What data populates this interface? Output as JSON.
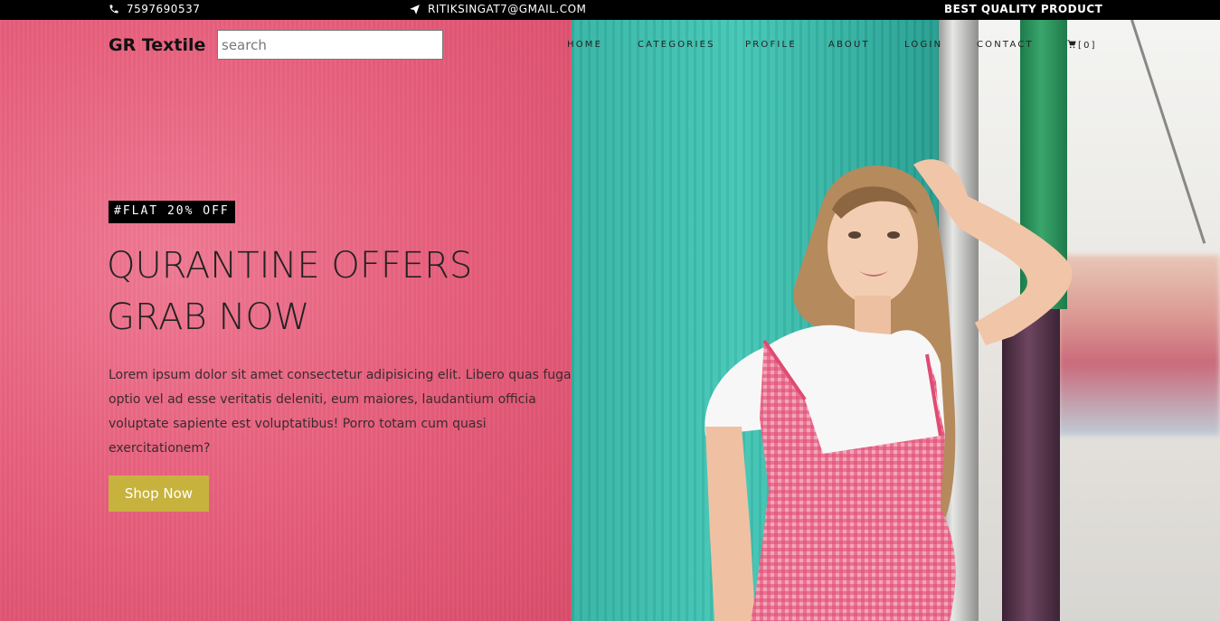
{
  "topbar": {
    "phone": "7597690537",
    "phone_icon": "phone-icon",
    "email": "RITIKSINGAT7@GMAIL.COM",
    "email_icon": "paper-plane-icon",
    "tagline": "BEST QUALITY PRODUCT"
  },
  "header": {
    "brand": "GR Textile",
    "search_placeholder": "search",
    "nav": [
      "HOME",
      "CATEGORIES",
      "PROFILE",
      "ABOUT",
      "LOGIN",
      "CONTACT"
    ],
    "cart_label": "[0]",
    "cart_icon": "cart-icon"
  },
  "hero": {
    "badge": "#FLAT 20% OFF",
    "headline_line1": "QURANTINE OFFERS",
    "headline_line2": "GRAB NOW",
    "description": "Lorem ipsum dolor sit amet consectetur adipisicing elit. Libero quas fuga optio vel ad esse veritatis deleniti, eum maiores, laudantium officia voluptate sapiente est voluptatibus! Porro totam cum quasi exercitationem?",
    "cta_label": "Shop Now"
  },
  "colors": {
    "topbar_bg": "#000000",
    "pink_wall": "#e8617e",
    "teal_wall": "#3ebfae",
    "button": "#c7b23e",
    "badge_bg": "#000000"
  }
}
